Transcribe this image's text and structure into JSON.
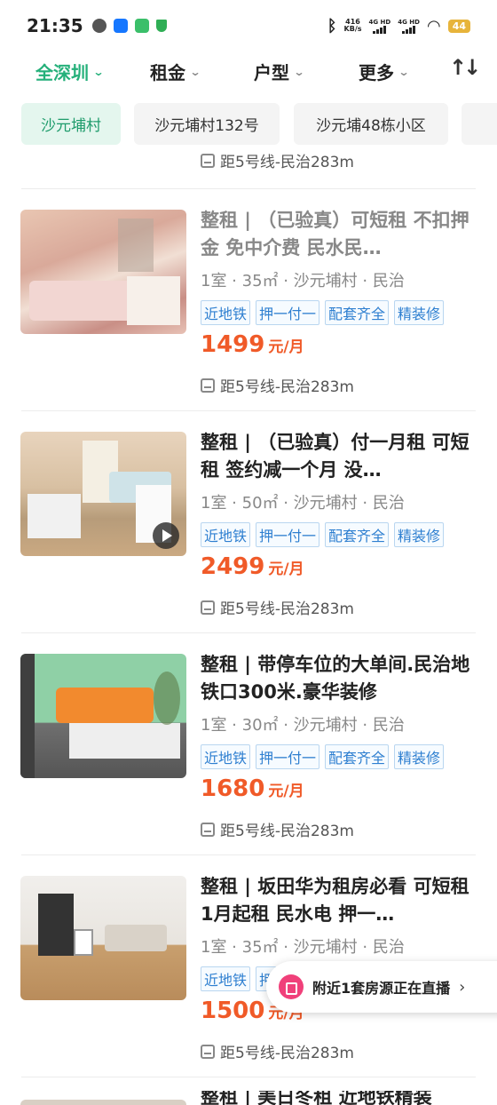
{
  "status": {
    "time": "21:35",
    "net_speed_value": "416",
    "net_speed_unit": "KB/s",
    "sim1": "4G HD",
    "sim2": "4G HD",
    "battery": "44"
  },
  "filters": {
    "city": "全深圳",
    "rent": "租金",
    "layout": "户型",
    "more": "更多",
    "sort_icon": "sort-icon"
  },
  "chips": [
    "沙元埔村",
    "沙元埔村132号",
    "沙元埔48栋小区"
  ],
  "top_partial": {
    "subway": "距5号线-民治283m"
  },
  "listings": [
    {
      "title": "整租 | （已验真）可短租 不扣押金 免中介费 民水民…",
      "meta": "1室 · 35㎡ · 沙元埔村 · 民治",
      "tags": [
        "近地铁",
        "押一付一",
        "配套齐全",
        "精装修"
      ],
      "price": "1499",
      "unit": "元/月",
      "subway": "距5号线-民治283m"
    },
    {
      "title": "整租 | （已验真）付一月租 可短租 签约减一个月 没…",
      "meta": "1室 · 50㎡ · 沙元埔村 · 民治",
      "tags": [
        "近地铁",
        "押一付一",
        "配套齐全",
        "精装修"
      ],
      "price": "2499",
      "unit": "元/月",
      "subway": "距5号线-民治283m"
    },
    {
      "title": "整租 | 带停车位的大单间.民治地铁口300米.豪华装修",
      "meta": "1室 · 30㎡ · 沙元埔村 · 民治",
      "tags": [
        "近地铁",
        "押一付一",
        "配套齐全",
        "精装修"
      ],
      "price": "1680",
      "unit": "元/月",
      "subway": "距5号线-民治283m"
    },
    {
      "title": "整租 | 坂田华为租房必看 可短租1月起租 民水电 押一…",
      "meta": "1室 · 35㎡ · 沙元埔村 · 民治",
      "tags": [
        "近地铁",
        "押"
      ],
      "price": "1500",
      "unit": "元/月",
      "subway": "距5号线-民治283m"
    }
  ],
  "bottom_partial": {
    "title": "整租 | 美日冬租 近地铁精装"
  },
  "live_banner": {
    "text": "附近1套房源正在直播",
    "arrow": "›"
  }
}
